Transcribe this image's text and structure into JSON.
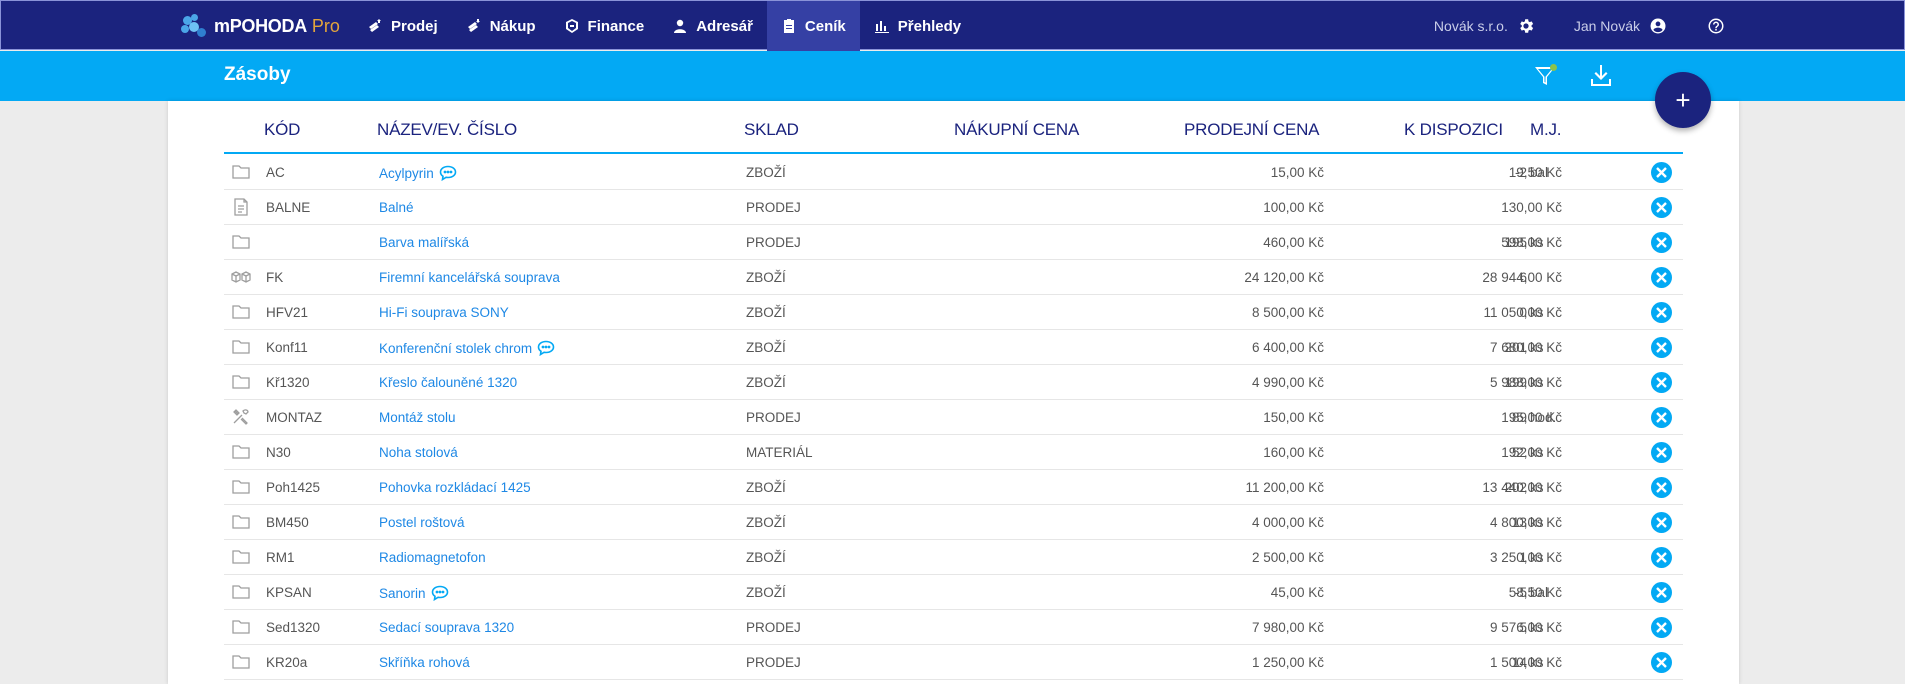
{
  "app": {
    "name": "mPOHODA",
    "edition": "Pro"
  },
  "nav": [
    {
      "label": "Prodej",
      "icon": "coins-up-icon"
    },
    {
      "label": "Nákup",
      "icon": "coins-down-icon"
    },
    {
      "label": "Finance",
      "icon": "finance-icon"
    },
    {
      "label": "Adresář",
      "icon": "person-icon"
    },
    {
      "label": "Ceník",
      "icon": "clipboard-icon",
      "active": true
    },
    {
      "label": "Přehledy",
      "icon": "bar-chart-icon"
    }
  ],
  "header": {
    "company": "Novák s.r.o.",
    "user": "Jan Novák"
  },
  "page": {
    "title": "Zásoby"
  },
  "columns": {
    "code": "KÓD",
    "name": "NÁZEV/EV. ČÍSLO",
    "store": "SKLAD",
    "buy": "NÁKUPNÍ CENA",
    "sell": "PRODEJNÍ CENA",
    "avail": "K DISPOZICI",
    "unit": "M.J."
  },
  "rows": [
    {
      "icon": "folder-icon",
      "code": "AC",
      "name": "Acylpyrin",
      "note": true,
      "store": "ZBOŽÍ",
      "buy": "15,00 Kč",
      "sell": "19,50 Kč",
      "qty": "-2",
      "unit": "bal"
    },
    {
      "icon": "document-icon",
      "code": "BALNE",
      "name": "Balné",
      "note": false,
      "store": "PRODEJ",
      "buy": "100,00 Kč",
      "sell": "130,00 Kč",
      "qty": "",
      "unit": ""
    },
    {
      "icon": "folder-icon",
      "code": "",
      "name": "Barva malířská",
      "note": false,
      "store": "PRODEJ",
      "buy": "460,00 Kč",
      "sell": "598,00 Kč",
      "qty": "195",
      "unit": "ks"
    },
    {
      "icon": "boxes-icon",
      "code": "FK",
      "name": "Firemní kancelářská souprava",
      "note": false,
      "store": "ZBOŽÍ",
      "buy": "24 120,00 Kč",
      "sell": "28 944,00 Kč",
      "qty": "6",
      "unit": ""
    },
    {
      "icon": "folder-icon",
      "code": "HFV21",
      "name": "Hi-Fi souprava SONY",
      "note": false,
      "store": "ZBOŽÍ",
      "buy": "8 500,00 Kč",
      "sell": "11 050,00 Kč",
      "qty": "0",
      "unit": "ks"
    },
    {
      "icon": "folder-icon",
      "code": "Konf11",
      "name": "Konferenční stolek chrom",
      "note": true,
      "store": "ZBOŽÍ",
      "buy": "6 400,00 Kč",
      "sell": "7 680,00 Kč",
      "qty": "201",
      "unit": "ks"
    },
    {
      "icon": "folder-icon",
      "code": "Kř1320",
      "name": "Křeslo čalouněné 1320",
      "note": false,
      "store": "ZBOŽÍ",
      "buy": "4 990,00 Kč",
      "sell": "5 988,00 Kč",
      "qty": "199",
      "unit": "ks"
    },
    {
      "icon": "tools-icon",
      "code": "MONTAZ",
      "name": "Montáž stolu",
      "note": false,
      "store": "PRODEJ",
      "buy": "150,00 Kč",
      "sell": "195,00 Kč",
      "qty": "89",
      "unit": "hod."
    },
    {
      "icon": "folder-icon",
      "code": "N30",
      "name": "Noha stolová",
      "note": false,
      "store": "MATERIÁL",
      "buy": "160,00 Kč",
      "sell": "192,00 Kč",
      "qty": "52",
      "unit": "ks"
    },
    {
      "icon": "folder-icon",
      "code": "Poh1425",
      "name": "Pohovka rozkládací 1425",
      "note": false,
      "store": "ZBOŽÍ",
      "buy": "11 200,00 Kč",
      "sell": "13 440,00 Kč",
      "qty": "202",
      "unit": "ks"
    },
    {
      "icon": "folder-icon",
      "code": "BM450",
      "name": "Postel roštová",
      "note": false,
      "store": "ZBOŽÍ",
      "buy": "4 000,00 Kč",
      "sell": "4 800,00 Kč",
      "qty": "13",
      "unit": "ks"
    },
    {
      "icon": "folder-icon",
      "code": "RM1",
      "name": "Radiomagnetofon",
      "note": false,
      "store": "ZBOŽÍ",
      "buy": "2 500,00 Kč",
      "sell": "3 250,00 Kč",
      "qty": "1",
      "unit": "ks"
    },
    {
      "icon": "folder-icon",
      "code": "KPSAN",
      "name": "Sanorin",
      "note": true,
      "store": "ZBOŽÍ",
      "buy": "45,00 Kč",
      "sell": "58,50 Kč",
      "qty": "-5",
      "unit": "bal"
    },
    {
      "icon": "folder-icon",
      "code": "Sed1320",
      "name": "Sedací souprava 1320",
      "note": false,
      "store": "PRODEJ",
      "buy": "7 980,00 Kč",
      "sell": "9 576,00 Kč",
      "qty": "5",
      "unit": "ks"
    },
    {
      "icon": "folder-icon",
      "code": "KR20a",
      "name": "Skříňka rohová",
      "note": false,
      "store": "PRODEJ",
      "buy": "1 250,00 Kč",
      "sell": "1 500,00 Kč",
      "qty": "14",
      "unit": "ks"
    }
  ]
}
